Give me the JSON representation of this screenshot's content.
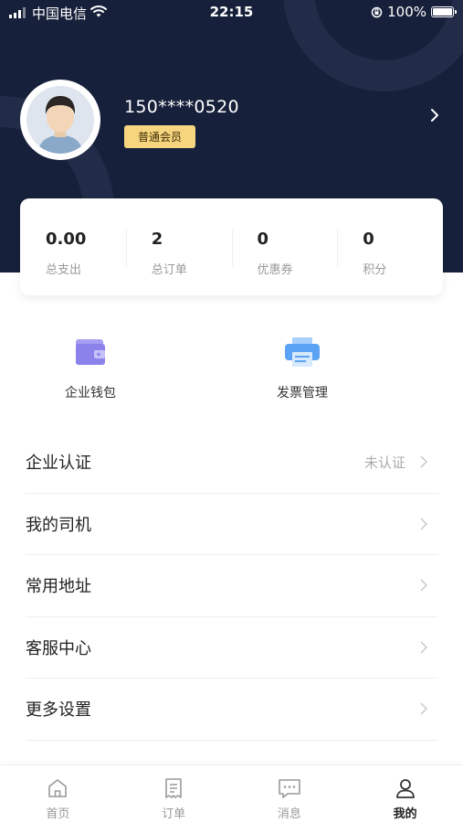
{
  "status_bar": {
    "carrier": "中国电信",
    "time": "22:15",
    "battery": "100%",
    "icons": [
      "signal-icon",
      "wifi-icon",
      "orientation-lock-icon",
      "battery-icon"
    ]
  },
  "profile": {
    "phone": "150****0520",
    "member_level": "普通会员",
    "avatar_icon": "user-avatar"
  },
  "stats": [
    {
      "value": "0.00",
      "label": "总支出"
    },
    {
      "value": "2",
      "label": "总订单"
    },
    {
      "value": "0",
      "label": "优惠券"
    },
    {
      "value": "0",
      "label": "积分"
    }
  ],
  "quick_actions": [
    {
      "label": "企业钱包",
      "icon": "wallet-icon"
    },
    {
      "label": "发票管理",
      "icon": "invoice-printer-icon"
    }
  ],
  "menu": [
    {
      "label": "企业认证",
      "value": "未认证"
    },
    {
      "label": "我的司机",
      "value": ""
    },
    {
      "label": "常用地址",
      "value": ""
    },
    {
      "label": "客服中心",
      "value": ""
    },
    {
      "label": "更多设置",
      "value": ""
    }
  ],
  "tabs": [
    {
      "label": "首页",
      "icon": "home-icon",
      "active": false
    },
    {
      "label": "订单",
      "icon": "order-icon",
      "active": false
    },
    {
      "label": "消息",
      "icon": "message-icon",
      "active": false
    },
    {
      "label": "我的",
      "icon": "profile-icon",
      "active": true
    }
  ],
  "colors": {
    "header_bg": "#17203a",
    "badge_bg": "#f6d57e",
    "wallet_icon": "#8b82ec",
    "invoice_icon": "#5ba3f4"
  }
}
